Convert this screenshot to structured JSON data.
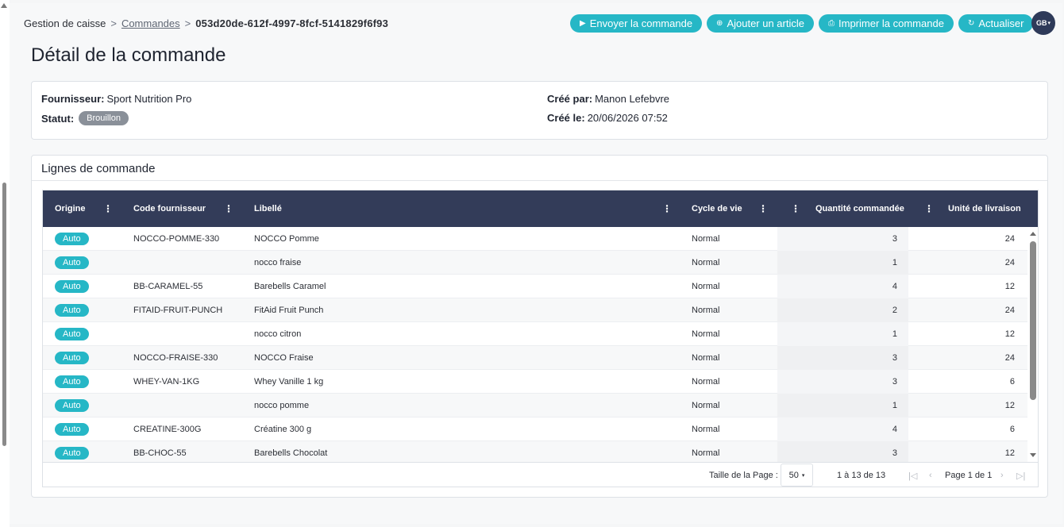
{
  "breadcrumb": {
    "root": "Gestion de caisse",
    "sep1": ">",
    "link": "Commandes",
    "sep2": ">",
    "current": "053d20de-612f-4997-8fcf-5141829f6f93"
  },
  "actions": [
    {
      "label": "Envoyer la commande",
      "icon": "▶"
    },
    {
      "label": "Ajouter un article",
      "icon": "⊕"
    },
    {
      "label": "Imprimer la commande",
      "icon": "⎙"
    },
    {
      "label": "Actualiser",
      "icon": "↻"
    }
  ],
  "avatar": {
    "initials": "GB",
    "caret": "▾"
  },
  "page_title": "Détail de la commande",
  "info": {
    "supplier_label": "Fournisseur:",
    "supplier_value": "Sport Nutrition Pro",
    "status_label": "Statut:",
    "status_value": "Brouillon",
    "created_by_label": "Créé par:",
    "created_by_value": "Manon Lefebvre",
    "created_at_label": "Créé le:",
    "created_at_value": "20/06/2026 07:52"
  },
  "lines": {
    "title": "Lignes de commande",
    "menu_icon": "⋮",
    "columns": {
      "origine": "Origine",
      "code": "Code fournisseur",
      "libelle": "Libellé",
      "cycle": "Cycle de vie",
      "quantite": "Quantité commandée",
      "unite": "Unité de livraison"
    },
    "rows": [
      {
        "origine": "Auto",
        "code": "NOCCO-POMME-330",
        "libelle": "NOCCO Pomme",
        "cycle": "Normal",
        "quantite": "3",
        "unite": "24"
      },
      {
        "origine": "Auto",
        "code": "",
        "libelle": "nocco fraise",
        "cycle": "Normal",
        "quantite": "1",
        "unite": "24"
      },
      {
        "origine": "Auto",
        "code": "BB-CARAMEL-55",
        "libelle": "Barebells Caramel",
        "cycle": "Normal",
        "quantite": "4",
        "unite": "12"
      },
      {
        "origine": "Auto",
        "code": "FITAID-FRUIT-PUNCH",
        "libelle": "FitAid Fruit Punch",
        "cycle": "Normal",
        "quantite": "2",
        "unite": "24"
      },
      {
        "origine": "Auto",
        "code": "",
        "libelle": "nocco citron",
        "cycle": "Normal",
        "quantite": "1",
        "unite": "12"
      },
      {
        "origine": "Auto",
        "code": "NOCCO-FRAISE-330",
        "libelle": "NOCCO Fraise",
        "cycle": "Normal",
        "quantite": "3",
        "unite": "24"
      },
      {
        "origine": "Auto",
        "code": "WHEY-VAN-1KG",
        "libelle": "Whey Vanille 1 kg",
        "cycle": "Normal",
        "quantite": "3",
        "unite": "6"
      },
      {
        "origine": "Auto",
        "code": "",
        "libelle": "nocco pomme",
        "cycle": "Normal",
        "quantite": "1",
        "unite": "12"
      },
      {
        "origine": "Auto",
        "code": "CREATINE-300G",
        "libelle": "Créatine 300 g",
        "cycle": "Normal",
        "quantite": "4",
        "unite": "6"
      },
      {
        "origine": "Auto",
        "code": "BB-CHOC-55",
        "libelle": "Barebells Chocolat",
        "cycle": "Normal",
        "quantite": "3",
        "unite": "12"
      }
    ],
    "footer": {
      "page_size_label": "Taille de la Page :",
      "page_size_value": "50",
      "page_size_caret": "▾",
      "range": "1 à 13 de 13",
      "page": "Page 1 de 1",
      "first": "|◁",
      "prev": "‹",
      "next": "›",
      "last": "▷|"
    }
  }
}
